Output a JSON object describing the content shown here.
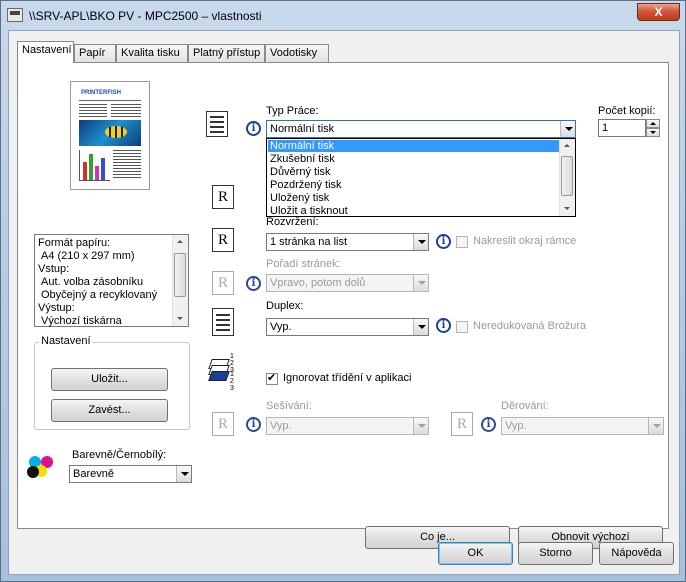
{
  "window": {
    "title": "\\\\SRV-APL\\BKO PV - MPC2500 – vlastnosti",
    "close_label": "X"
  },
  "tabs": [
    {
      "label": "Nastavení",
      "active": true
    },
    {
      "label": "Papír",
      "active": false
    },
    {
      "label": "Kvalita tisku",
      "active": false
    },
    {
      "label": "Platný přístup",
      "active": false
    },
    {
      "label": "Vodotisky",
      "active": false
    }
  ],
  "preview": {
    "brand_text": "PRINTERFISH"
  },
  "summary_list": {
    "items": [
      "Formát papíru:",
      "A4 (210 x 297 mm)",
      "Vstup:",
      "Aut. volba zásobníku",
      "Obyčejný a recyklovaný",
      "Výstup:",
      "Výchozí tiskárna"
    ]
  },
  "settings_group": {
    "title": "Nastavení",
    "save_label": "Uložit...",
    "load_label": "Zavést..."
  },
  "color": {
    "label": "Barevně/Černobílý:",
    "value": "Barevně"
  },
  "job_type": {
    "label": "Typ Práce:",
    "value": "Normální tisk",
    "options": [
      "Normální tisk",
      "Zkušební tisk",
      "Důvěrný tisk",
      "Pozdržený tisk",
      "Uložený tisk",
      "Uložit a tisknout"
    ],
    "selected_index": 0
  },
  "copies": {
    "label": "Počet kopií:",
    "value": "1"
  },
  "layout": {
    "label": "Rozvržení:",
    "value": "1 stránka na list",
    "frame_label": "Nakreslit okraj rámce",
    "frame_checked": false
  },
  "page_order": {
    "label": "Pořadí stránek:",
    "value": "Vpravo, potom dolů"
  },
  "duplex": {
    "label": "Duplex:",
    "value": "Vyp.",
    "booklet_label": "Neredukovaná Brožura",
    "booklet_checked": false
  },
  "collate": {
    "label": "Ignorovat třídění v aplikaci",
    "checked": true,
    "digits_top": "1 2 3",
    "digits_bottom": "1 2 3"
  },
  "staple": {
    "label": "Sešívání:",
    "value": "Vyp."
  },
  "punch": {
    "label": "Děrování:",
    "value": "Vyp."
  },
  "buttons": {
    "whatis": "Co je...",
    "restore": "Obnovit výchozí",
    "ok": "OK",
    "cancel": "Storno",
    "help": "Nápověda"
  },
  "icons": {
    "r_glyph": "R",
    "info_glyph": "i"
  }
}
